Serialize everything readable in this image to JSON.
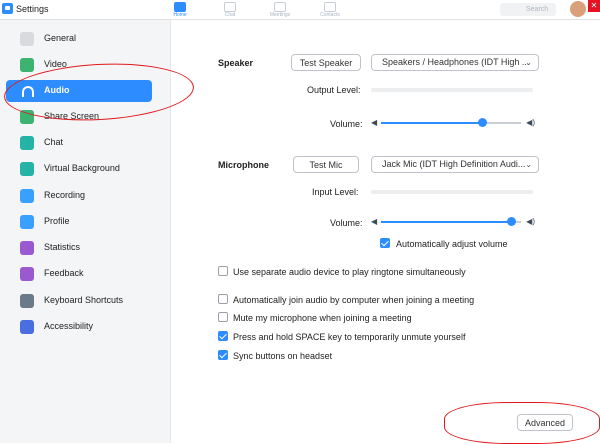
{
  "window": {
    "title": "Settings",
    "close_glyph": "✕"
  },
  "topnav": [
    {
      "label": "Home",
      "icon": "home-icon"
    },
    {
      "label": "Chat",
      "icon": "chat-icon"
    },
    {
      "label": "Meetings",
      "icon": "clock-icon"
    },
    {
      "label": "Contacts",
      "icon": "contacts-icon"
    }
  ],
  "search": {
    "placeholder": "Search"
  },
  "sidebar": {
    "items": [
      {
        "label": "General",
        "icon": "gear-icon",
        "color": "#d8dadd"
      },
      {
        "label": "Video",
        "icon": "video-camera-icon",
        "color": "#3cb371"
      },
      {
        "label": "Audio",
        "icon": "headphones-icon",
        "color": "#2d8cff",
        "active": true
      },
      {
        "label": "Share Screen",
        "icon": "share-screen-icon",
        "color": "#3cb371"
      },
      {
        "label": "Chat",
        "icon": "chat-bubble-icon",
        "color": "#26b3a7"
      },
      {
        "label": "Virtual Background",
        "icon": "user-background-icon",
        "color": "#26b3a7"
      },
      {
        "label": "Recording",
        "icon": "record-icon",
        "color": "#3aa0ff"
      },
      {
        "label": "Profile",
        "icon": "profile-icon",
        "color": "#3aa0ff"
      },
      {
        "label": "Statistics",
        "icon": "bar-chart-icon",
        "color": "#9b59d0"
      },
      {
        "label": "Feedback",
        "icon": "smiley-icon",
        "color": "#9b59d0"
      },
      {
        "label": "Keyboard Shortcuts",
        "icon": "keyboard-icon",
        "color": "#6b7a8a"
      },
      {
        "label": "Accessibility",
        "icon": "accessibility-icon",
        "color": "#4a6ee0"
      }
    ]
  },
  "speaker": {
    "label": "Speaker",
    "test_button": "Test Speaker",
    "device": "Speakers / Headphones (IDT High ...",
    "output_level_label": "Output Level:",
    "volume_label": "Volume:",
    "volume_level": 0.72
  },
  "microphone": {
    "label": "Microphone",
    "test_button": "Test Mic",
    "device": "Jack Mic (IDT High Definition Audi...",
    "input_level_label": "Input Level:",
    "volume_label": "Volume:",
    "volume_level": 0.93
  },
  "options": {
    "auto_adjust": {
      "label": "Automatically adjust volume",
      "checked": true
    },
    "separate_ringtone": {
      "label": "Use separate audio device to play ringtone simultaneously",
      "checked": false
    },
    "auto_join": {
      "label": "Automatically join audio by computer when joining a meeting",
      "checked": false
    },
    "mute_mic": {
      "label": "Mute my microphone when joining a meeting",
      "checked": false
    },
    "space_unmute": {
      "label": "Press and hold SPACE key to temporarily unmute yourself",
      "checked": true
    },
    "sync_headset": {
      "label": "Sync buttons on headset",
      "checked": true
    }
  },
  "advanced_button": "Advanced",
  "colors": {
    "accent": "#2d8cff",
    "annotation": "#e0191c"
  }
}
